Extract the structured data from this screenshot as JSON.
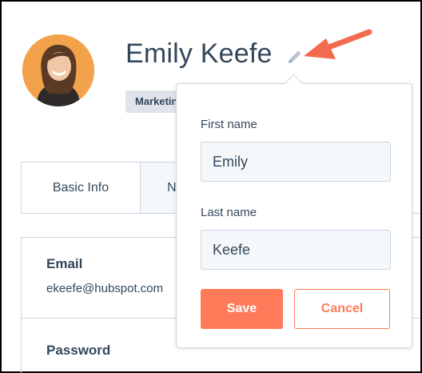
{
  "profile": {
    "name": "Emily Keefe",
    "team_badge": "Marketing"
  },
  "icons": {
    "edit": "pencil-icon",
    "pointer": "arrow-icon"
  },
  "tabs": [
    {
      "label": "Basic Info",
      "active": true
    },
    {
      "label": "N",
      "active": false
    }
  ],
  "details": {
    "email_label": "Email",
    "email_value": "ekeefe@hubspot.com",
    "password_label": "Password"
  },
  "edit_popover": {
    "first_name_label": "First name",
    "first_name_value": "Emily",
    "last_name_label": "Last name",
    "last_name_value": "Keefe",
    "save_label": "Save",
    "cancel_label": "Cancel"
  },
  "colors": {
    "accent": "#ff7a59",
    "text": "#33475b",
    "border": "#cbd6e2",
    "input_bg": "#f5f8fa",
    "badge_bg": "#dfe3eb"
  }
}
